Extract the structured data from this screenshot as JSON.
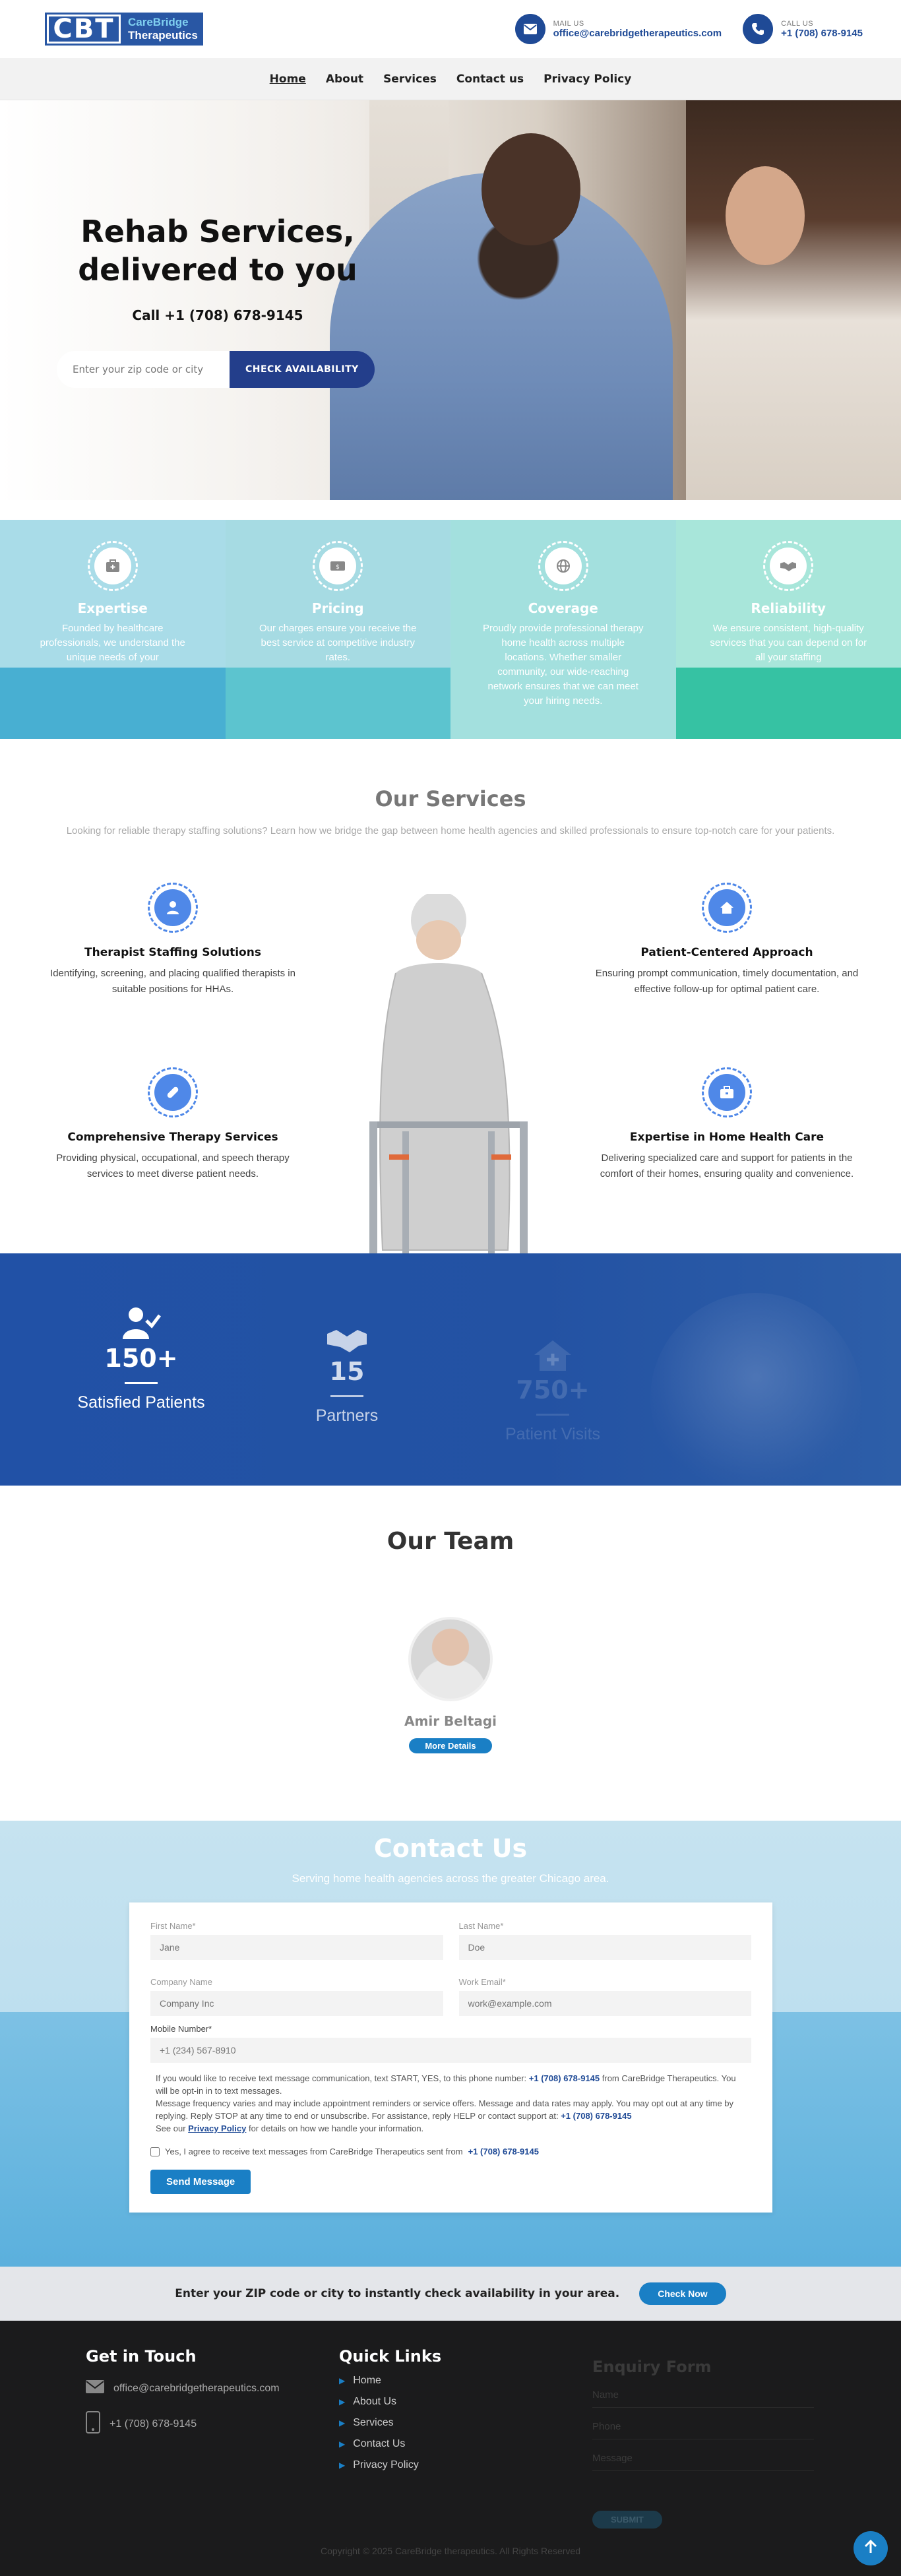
{
  "brand": {
    "mark": "CBT",
    "line1": "CareBridge",
    "line2": "Therapeutics"
  },
  "header": {
    "mail_label": "MAIL US",
    "mail_value": "office@carebridgetherapeutics.com",
    "call_label": "CALL US",
    "call_value": "+1 (708) 678-9145"
  },
  "nav": {
    "items": [
      "Home",
      "About",
      "Services",
      "Contact us",
      "Privacy Policy"
    ]
  },
  "hero": {
    "title_line1": "Rehab Services,",
    "title_line2": "delivered to you",
    "call": "Call +1 (708) 678-9145",
    "search_placeholder": "Enter your zip code or city",
    "search_button": "CHECK AVAILABILITY"
  },
  "features": [
    {
      "title": "Expertise",
      "text": "Founded by healthcare professionals, we understand the unique needs of your",
      "icon": "medkit-icon",
      "top": "#a9dce8",
      "bottom": "#48afd2"
    },
    {
      "title": "Pricing",
      "text": "Our charges ensure you receive the best service at competitive industry rates.",
      "icon": "price-tag-icon",
      "top": "#a6dbe3",
      "bottom": "#5cc4cf"
    },
    {
      "title": "Coverage",
      "text": "Proudly provide professional therapy home health across multiple locations. Whether smaller community, our wide-reaching network ensures that we can meet your hiring needs.",
      "icon": "globe-icon",
      "top": "#a3e0de",
      "bottom": "#a3e0de"
    },
    {
      "title": "Reliability",
      "text": "We ensure consistent, high-quality services that you can depend on for all your staffing",
      "icon": "handshake-icon",
      "top": "#a8e6da",
      "bottom": "#36c2a3"
    }
  ],
  "services": {
    "title": "Our Services",
    "subtitle": "Looking for reliable therapy staffing solutions? Learn how we bridge the gap between home health agencies and skilled professionals to ensure top-notch care for your patients.",
    "items": [
      {
        "title": "Therapist Staffing Solutions",
        "text": "Identifying, screening, and placing qualified therapists in suitable positions for HHAs.",
        "icon": "user-icon"
      },
      {
        "title": "Patient-Centered Approach",
        "text": "Ensuring prompt communication, timely documentation, and effective follow-up for optimal patient care.",
        "icon": "home-icon"
      },
      {
        "title": "Comprehensive Therapy Services",
        "text": "Providing physical, occupational, and speech therapy services to meet diverse patient needs.",
        "icon": "pill-icon"
      },
      {
        "title": "Expertise in Home Health Care",
        "text": "Delivering specialized care and support for patients in the comfort of their homes, ensuring quality and convenience.",
        "icon": "briefcase-icon"
      }
    ]
  },
  "stats": [
    {
      "value": "150+",
      "label": "Satisfied Patients",
      "icon": "user-check-icon"
    },
    {
      "value": "15",
      "label": "Partners",
      "icon": "handshake-icon"
    },
    {
      "value": "750+",
      "label": "Patient Visits",
      "icon": "house-medical-icon"
    }
  ],
  "team": {
    "title": "Our Team",
    "member_name": "Amir Beltagi",
    "details_button": "More Details"
  },
  "contact": {
    "title": "Contact Us",
    "subtitle": "Serving home health agencies across the greater Chicago area.",
    "first_name_label": "First Name*",
    "first_name_placeholder": "Jane",
    "last_name_label": "Last Name*",
    "last_name_placeholder": "Doe",
    "company_label": "Company Name",
    "company_placeholder": "Company Inc",
    "email_label": "Work Email*",
    "email_placeholder": "work@example.com",
    "mobile_label": "Mobile Number*",
    "mobile_placeholder": "+1 (234) 567-8910",
    "fine1": "If you would like to receive text message communication, text START, YES, to this phone number:",
    "fine_phone": "+1 (708) 678-9145",
    "fine2": "from CareBridge Therapeutics. You will be opt-in in to text messages.",
    "fine3": "Message frequency varies and may include appointment reminders or service offers. Message and data rates may apply. You may opt out at any time by replying. Reply STOP at any time to end or unsubscribe. For assistance, reply HELP or contact support at:",
    "fine4_prefix": "See our",
    "fine4_link": "Privacy Policy",
    "fine4_suffix": "for details on how we handle your information.",
    "consent_text": "Yes, I agree to receive text messages from CareBridge Therapeutics sent from",
    "consent_phone": "+1 (708) 678-9145",
    "send_button": "Send Message"
  },
  "zipband": {
    "text": "Enter your ZIP code or city to instantly check availability in your area.",
    "button": "Check Now"
  },
  "footer": {
    "get_in_touch": "Get in Touch",
    "email": "office@carebridgetherapeutics.com",
    "phone": "+1 (708) 678-9145",
    "quick_links_title": "Quick Links",
    "quick_links": [
      "Home",
      "About Us",
      "Services",
      "Contact Us",
      "Privacy Policy"
    ],
    "enquiry_title": "Enquiry Form",
    "enquiry_name": "Name",
    "enquiry_phone": "Phone",
    "enquiry_message": "Message",
    "enquiry_submit": "SUBMIT",
    "copyright": "Copyright © 2025 CareBridge therapeutics. All Rights Reserved"
  },
  "colors": {
    "primary": "#1f4a96",
    "accent": "#1a7fc5",
    "dark": "#1b1b1c"
  }
}
